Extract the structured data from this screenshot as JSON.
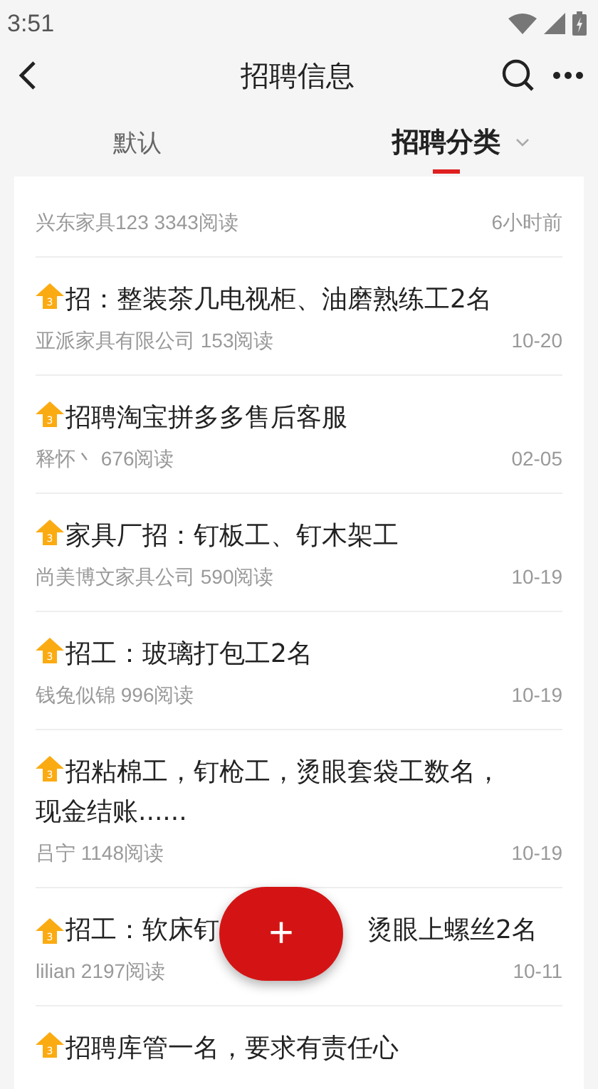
{
  "status_bar": {
    "time": "3:51"
  },
  "header": {
    "title": "招聘信息"
  },
  "tabs": [
    {
      "label": "默认",
      "selected": false
    },
    {
      "label": "招聘分类",
      "selected": true
    }
  ],
  "posts": [
    {
      "kind": "partial",
      "author": "兴东家具123",
      "reads": "3343阅读",
      "time": "6小时前"
    },
    {
      "kind": "post",
      "badge": "3",
      "title": "招：整装茶几电视柜、油磨熟练工2名",
      "author": "亚派家具有限公司",
      "reads": "153阅读",
      "time": "10-20"
    },
    {
      "kind": "post",
      "badge": "3",
      "title": "招聘淘宝拼多多售后客服",
      "author": "释怀丶",
      "reads": "676阅读",
      "time": "02-05"
    },
    {
      "kind": "post",
      "badge": "3",
      "title": "家具厂招：钉板工、钉木架工",
      "author": "尚美博文家具公司",
      "reads": "590阅读",
      "time": "10-19"
    },
    {
      "kind": "post",
      "badge": "3",
      "title": "招工：玻璃打包工2名",
      "author": "钱兔似锦",
      "reads": "996阅读",
      "time": "10-19"
    },
    {
      "kind": "post",
      "badge": "3",
      "title": "招粘棉工，钉枪工，烫眼套袋工数名，现金结账......",
      "author": "吕宁",
      "reads": "1148阅读",
      "time": "10-19"
    },
    {
      "kind": "covered",
      "badge": "3",
      "title_parts": [
        "招工：软床钉",
        "烫眼上螺丝2名"
      ],
      "author": "lilian",
      "reads": "2197阅读",
      "time": "10-11"
    },
    {
      "kind": "cut",
      "badge": "3",
      "title": "招聘库管一名，要求有责任心"
    }
  ],
  "fab": {
    "label": "+"
  }
}
